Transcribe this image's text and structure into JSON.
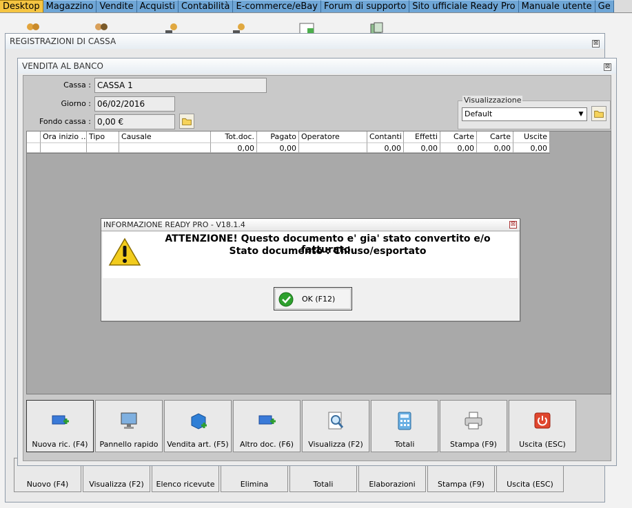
{
  "tabs": [
    {
      "label": "Desktop",
      "active": true
    },
    {
      "label": "Magazzino"
    },
    {
      "label": "Vendite"
    },
    {
      "label": "Acquisti"
    },
    {
      "label": "Contabilità"
    },
    {
      "label": "E-commerce/eBay"
    },
    {
      "label": "Forum di supporto"
    },
    {
      "label": "Sito ufficiale Ready Pro"
    },
    {
      "label": "Manuale utente"
    },
    {
      "label": "Ge"
    }
  ],
  "reg_window": {
    "title": "REGISTRAZIONI DI CASSA",
    "close": "⊠"
  },
  "vend_window": {
    "title": "VENDITA AL BANCO",
    "close": "⊠"
  },
  "form": {
    "cassa_label": "Cassa :",
    "cassa_value": "CASSA 1",
    "giorno_label": "Giorno :",
    "giorno_value": "06/02/2016",
    "fondo_label": "Fondo cassa :",
    "fondo_value": "0,00 €"
  },
  "visualizzazione": {
    "legend": "Visualizzazione",
    "selected": "Default"
  },
  "grid": {
    "columns": [
      "",
      "Ora inizio ...",
      "Tipo",
      "Causale",
      "Tot.doc.",
      "Pagato",
      "Operatore",
      "Contanti",
      "Effetti",
      "Carte",
      "Carte",
      "Uscite"
    ],
    "row": [
      "",
      "",
      "",
      "",
      "0,00",
      "0,00",
      "",
      "0,00",
      "0,00",
      "0,00",
      "0,00",
      "0,00"
    ]
  },
  "toolbar": [
    {
      "label": "Nuova ric. (F4)",
      "icon": "new-receipt-icon"
    },
    {
      "label": "Pannello rapido",
      "icon": "monitor-icon"
    },
    {
      "label": "Vendita art. (F5)",
      "icon": "box-add-icon"
    },
    {
      "label": "Altro doc. (F6)",
      "icon": "doc-add-icon"
    },
    {
      "label": "Visualizza (F2)",
      "icon": "magnifier-icon"
    },
    {
      "label": "Totali",
      "icon": "calculator-icon"
    },
    {
      "label": "Stampa (F9)",
      "icon": "printer-icon"
    },
    {
      "label": "Uscita (ESC)",
      "icon": "power-icon"
    }
  ],
  "reg_toolbar": [
    {
      "label": "Nuovo (F4)"
    },
    {
      "label": "Visualizza (F2)"
    },
    {
      "label": "Elenco ricevute"
    },
    {
      "label": "Elimina"
    },
    {
      "label": "Totali"
    },
    {
      "label": "Elaborazioni"
    },
    {
      "label": "Stampa (F9)"
    },
    {
      "label": "Uscita (ESC)"
    }
  ],
  "dialog": {
    "title": "INFORMAZIONE READY PRO - V18.1.4",
    "close": "⊠",
    "line1": "ATTENZIONE! Questo documento e' gia' stato convertito e/o fatturato.",
    "line2": "Stato documento : Chiuso/esportato",
    "ok_label": "OK (F12)"
  },
  "colors": {
    "tab_active": "#f6c542",
    "tab": "#6fa6d6",
    "ok_green": "#2ea02e",
    "warning_yellow": "#f2cc1d"
  }
}
